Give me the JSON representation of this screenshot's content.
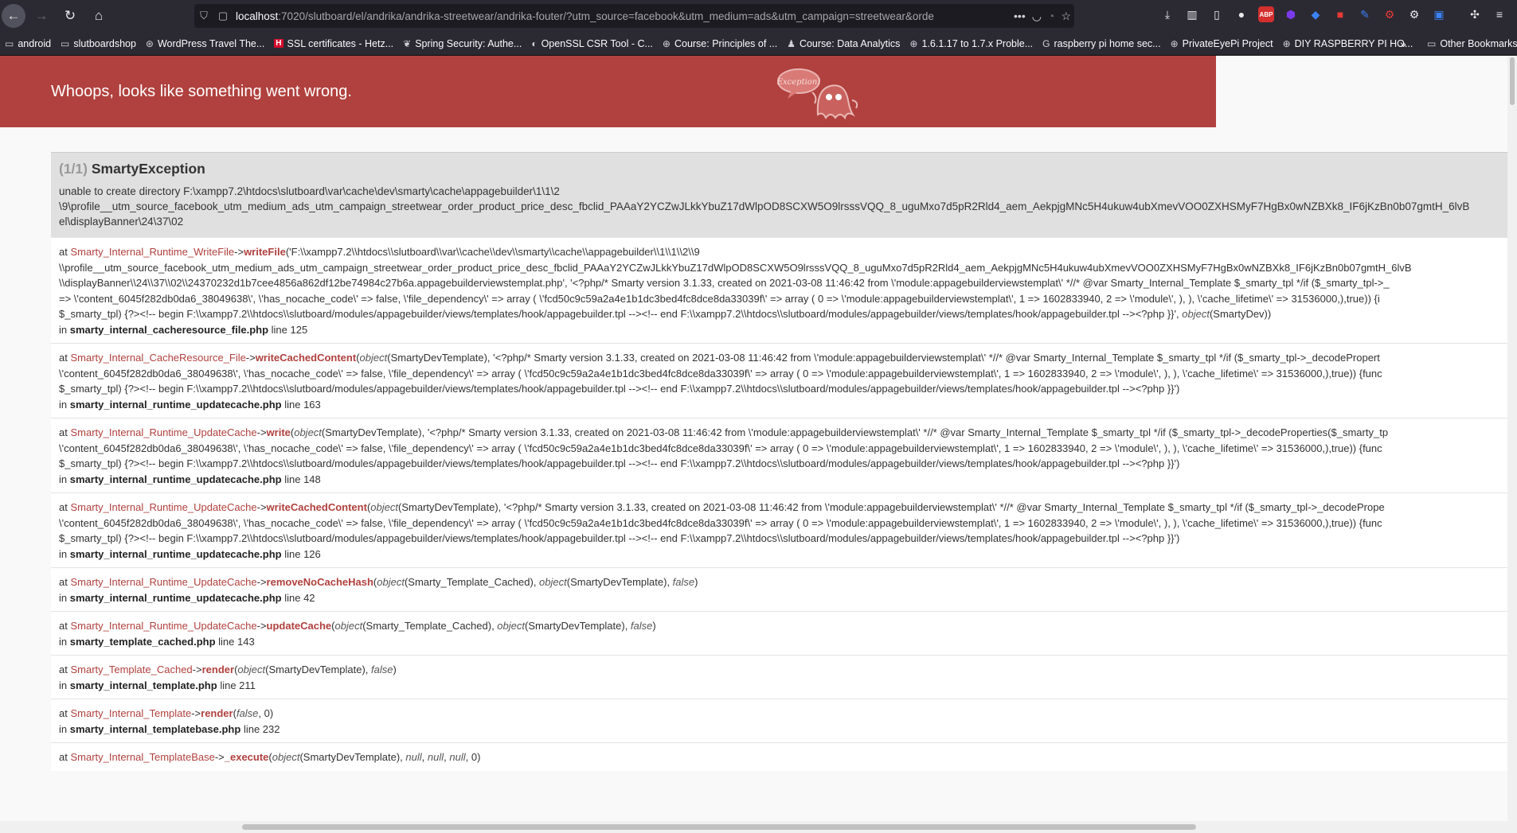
{
  "browser": {
    "url_host": "localhost",
    "url_path": ":7020/slutboard/el/andrika/andrika-streetwear/andrika-fouter/?utm_source=facebook&utm_medium=ads&utm_campaign=streetwear&orde",
    "more_label": "•••"
  },
  "bookmarks": {
    "items": [
      {
        "label": "android",
        "icon": "folder-icon"
      },
      {
        "label": "slutboardshop",
        "icon": "folder-icon"
      },
      {
        "label": "WordPress Travel The...",
        "icon": "wordpress-icon"
      },
      {
        "label": "SSL certificates - Hetz...",
        "icon": "hetzner-icon"
      },
      {
        "label": "Spring Security: Authe...",
        "icon": "spring-icon"
      },
      {
        "label": "OpenSSL CSR Tool - C...",
        "icon": "digicert-icon"
      },
      {
        "label": "Course: Principles of ...",
        "icon": "globe-icon"
      },
      {
        "label": "Course: Data Analytics",
        "icon": "person-icon"
      },
      {
        "label": "1.6.1.17 to 1.7.x Proble...",
        "icon": "globe-icon"
      },
      {
        "label": "raspberry pi home sec...",
        "icon": "google-icon"
      },
      {
        "label": "PrivateEyePi Project",
        "icon": "globe-icon"
      },
      {
        "label": "DIY RASPBERRY PI HO...",
        "icon": "globe-icon"
      }
    ],
    "other_label": "Other Bookmarks"
  },
  "exception": {
    "header_title": "Whoops, looks like something went wrong.",
    "ghost_label": "Exception!",
    "count": "(1/1)",
    "class": "SmartyException",
    "message_lines": [
      "unable to create directory F:\\xampp7.2\\htdocs\\slutboard\\var\\cache\\dev\\smarty\\cache\\appagebuilder\\1\\1\\2",
      "\\9\\profile__utm_source_facebook_utm_medium_ads_utm_campaign_streetwear_order_product_price_desc_fbclid_PAAaY2YCZwJLkkYbuZ17dWlpOD8SCXW5O9lrsssVQQ_8_uguMxo7d5pR2Rld4_aem_AekpjgMNc5H4ukuw4ubXmevVOO0ZXHSMyF7HgBx0wNZBXk8_IF6jKzBn0b07gmtH_6lvB",
      "el\\displayBanner\\24\\37\\02"
    ]
  },
  "trace": [
    {
      "class": "Smarty_Internal_Runtime_WriteFile",
      "method": "writeFile",
      "args_lines": [
        "('F:\\\\xampp7.2\\\\htdocs\\\\slutboard\\\\var\\\\cache\\\\dev\\\\smarty\\\\cache\\\\appagebuilder\\\\1\\\\1\\\\2\\\\9",
        "\\\\profile__utm_source_facebook_utm_medium_ads_utm_campaign_streetwear_order_product_price_desc_fbclid_PAAaY2YCZwJLkkYbuZ17dWlpOD8SCXW5O9lrsssVQQ_8_uguMxo7d5pR2Rld4_aem_AekpjgMNc5H4ukuw4ubXmevVOO0ZXHSMyF7HgBx0wNZBXk8_IF6jKzBn0b07gmtH_6lvB",
        "\\\\displayBanner\\\\24\\\\37\\\\02\\\\24370232d1b7cee4856a862df12be74984c27b6a.appagebuilderviewstemplat.php', '<?php/* Smarty version 3.1.33, created on 2021-03-08 11:46:42 from \\'module:appagebuilderviewstemplat\\' *//* @var Smarty_Internal_Template $_smarty_tpl */if ($_smarty_tpl->_",
        "=> \\'content_6045f282db0da6_38049638\\', \\'has_nocache_code\\' => false, \\'file_dependency\\' => array ( \\'fcd50c9c59a2a4e1b1dc3bed4fc8dce8da33039f\\' => array ( 0 => \\'module:appagebuilderviewstemplat\\', 1 => 1602833940, 2 => \\'module\\', ), ), \\'cache_lifetime\\' => 31536000,),true)) {i",
        "$_smarty_tpl) {?><!-- begin F:\\\\xampp7.2\\\\htdocs\\\\slutboard/modules/appagebuilder/views/templates/hook/appagebuilder.tpl --><!-- end F:\\\\xampp7.2\\\\htdocs\\\\slutboard/modules/appagebuilder/views/templates/hook/appagebuilder.tpl --><?php }}', object(SmartyDev))"
      ],
      "file": "smarty_internal_cacheresource_file.php",
      "line": "line 125"
    },
    {
      "class": "Smarty_Internal_CacheResource_File",
      "method": "writeCachedContent",
      "args_lines": [
        "(object(SmartyDevTemplate), '<?php/* Smarty version 3.1.33, created on 2021-03-08 11:46:42 from \\'module:appagebuilderviewstemplat\\' *//* @var Smarty_Internal_Template $_smarty_tpl */if ($_smarty_tpl->_decodePropert",
        "\\'content_6045f282db0da6_38049638\\', \\'has_nocache_code\\' => false, \\'file_dependency\\' => array ( \\'fcd50c9c59a2a4e1b1dc3bed4fc8dce8da33039f\\' => array ( 0 => \\'module:appagebuilderviewstemplat\\', 1 => 1602833940, 2 => \\'module\\', ), ), \\'cache_lifetime\\' => 31536000,),true)) {func",
        "$_smarty_tpl) {?><!-- begin F:\\\\xampp7.2\\\\htdocs\\\\slutboard/modules/appagebuilder/views/templates/hook/appagebuilder.tpl --><!-- end F:\\\\xampp7.2\\\\htdocs\\\\slutboard/modules/appagebuilder/views/templates/hook/appagebuilder.tpl --><?php }}')"
      ],
      "file": "smarty_internal_runtime_updatecache.php",
      "line": "line 163"
    },
    {
      "class": "Smarty_Internal_Runtime_UpdateCache",
      "method": "write",
      "args_lines": [
        "(object(SmartyDevTemplate), '<?php/* Smarty version 3.1.33, created on 2021-03-08 11:46:42 from \\'module:appagebuilderviewstemplat\\' *//* @var Smarty_Internal_Template $_smarty_tpl */if ($_smarty_tpl->_decodeProperties($_smarty_tp",
        "\\'content_6045f282db0da6_38049638\\', \\'has_nocache_code\\' => false, \\'file_dependency\\' => array ( \\'fcd50c9c59a2a4e1b1dc3bed4fc8dce8da33039f\\' => array ( 0 => \\'module:appagebuilderviewstemplat\\', 1 => 1602833940, 2 => \\'module\\', ), ), \\'cache_lifetime\\' => 31536000,),true)) {func",
        "$_smarty_tpl) {?><!-- begin F:\\\\xampp7.2\\\\htdocs\\\\slutboard/modules/appagebuilder/views/templates/hook/appagebuilder.tpl --><!-- end F:\\\\xampp7.2\\\\htdocs\\\\slutboard/modules/appagebuilder/views/templates/hook/appagebuilder.tpl --><?php }}')"
      ],
      "file": "smarty_internal_runtime_updatecache.php",
      "line": "line 148"
    },
    {
      "class": "Smarty_Internal_Runtime_UpdateCache",
      "method": "writeCachedContent",
      "args_lines": [
        "(object(SmartyDevTemplate), '<?php/* Smarty version 3.1.33, created on 2021-03-08 11:46:42 from \\'module:appagebuilderviewstemplat\\' *//* @var Smarty_Internal_Template $_smarty_tpl */if ($_smarty_tpl->_decodePrope",
        "\\'content_6045f282db0da6_38049638\\', \\'has_nocache_code\\' => false, \\'file_dependency\\' => array ( \\'fcd50c9c59a2a4e1b1dc3bed4fc8dce8da33039f\\' => array ( 0 => \\'module:appagebuilderviewstemplat\\', 1 => 1602833940, 2 => \\'module\\', ), ), \\'cache_lifetime\\' => 31536000,),true)) {func",
        "$_smarty_tpl) {?><!-- begin F:\\\\xampp7.2\\\\htdocs\\\\slutboard/modules/appagebuilder/views/templates/hook/appagebuilder.tpl --><!-- end F:\\\\xampp7.2\\\\htdocs\\\\slutboard/modules/appagebuilder/views/templates/hook/appagebuilder.tpl --><?php }}')"
      ],
      "file": "smarty_internal_runtime_updatecache.php",
      "line": "line 126"
    },
    {
      "class": "Smarty_Internal_Runtime_UpdateCache",
      "method": "removeNoCacheHash",
      "args_lines": [
        "(object(Smarty_Template_Cached), object(SmartyDevTemplate), false)"
      ],
      "file": "smarty_internal_runtime_updatecache.php",
      "line": "line 42"
    },
    {
      "class": "Smarty_Internal_Runtime_UpdateCache",
      "method": "updateCache",
      "args_lines": [
        "(object(Smarty_Template_Cached), object(SmartyDevTemplate), false)"
      ],
      "file": "smarty_template_cached.php",
      "line": "line 143"
    },
    {
      "class": "Smarty_Template_Cached",
      "method": "render",
      "args_lines": [
        "(object(SmartyDevTemplate), false)"
      ],
      "file": "smarty_internal_template.php",
      "line": "line 211"
    },
    {
      "class": "Smarty_Internal_Template",
      "method": "render",
      "args_lines": [
        "(false, 0)"
      ],
      "file": "smarty_internal_templatebase.php",
      "line": "line 232"
    },
    {
      "class": "Smarty_Internal_TemplateBase",
      "method": "_execute",
      "args_lines": [
        "(object(SmartyDevTemplate), null, null, null, 0)"
      ],
      "file": "",
      "line": ""
    }
  ]
}
